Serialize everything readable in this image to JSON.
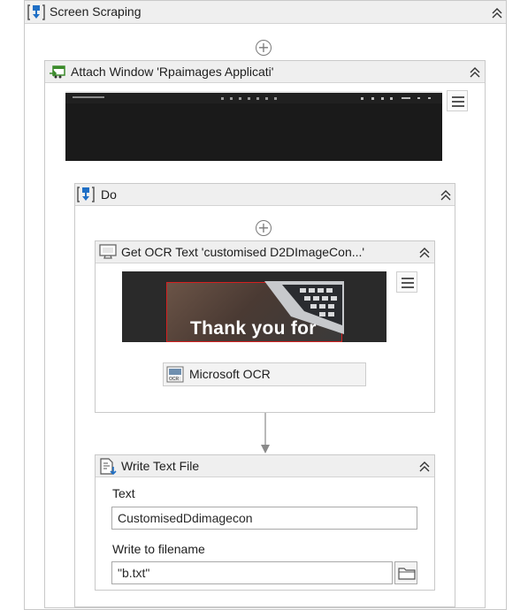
{
  "screen_scraping": {
    "title": "Screen Scraping"
  },
  "attach_window": {
    "title": "Attach Window 'Rpaimages Applicati'"
  },
  "do": {
    "title": "Do"
  },
  "ocr": {
    "title": "Get OCR Text 'customised  D2DImageCon...'",
    "preview_text": "Thank you for",
    "engine_label": "Microsoft OCR",
    "engine_icon_text": "OCR"
  },
  "write_text_file": {
    "title": "Write Text File",
    "text_label": "Text",
    "text_value": "CustomisedDdimagecon",
    "filename_label": "Write to filename",
    "filename_value": "\"b.txt\""
  },
  "icons": {
    "sequence": "sequence-icon",
    "attach": "attach-window-icon",
    "ocr": "ocr-monitor-icon",
    "write": "write-file-icon",
    "collapse": "collapse-chevron-icon",
    "add": "add-activity-icon",
    "menu": "hamburger-menu-icon",
    "folder": "folder-icon"
  },
  "colors": {
    "header_bg": "#efefef",
    "border": "#c9c9c9",
    "accent_blue": "#1f6fc5",
    "accent_green": "#3a8a2a",
    "highlight_red": "#d42020"
  }
}
